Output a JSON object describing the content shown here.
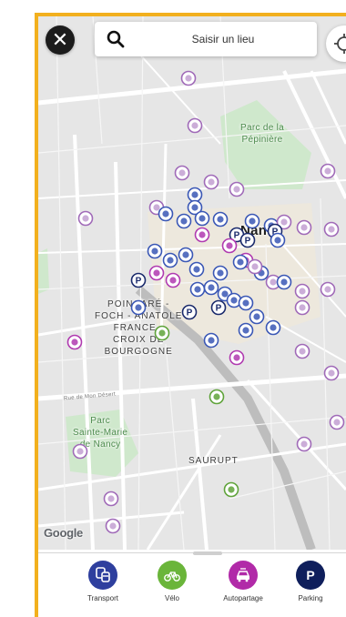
{
  "search": {
    "placeholder": "Saisir un lieu"
  },
  "controls": {
    "close_glyph": "✕"
  },
  "map": {
    "attribution": "Google",
    "labels": {
      "park_pepiniere": "Parc de la\nPépinière",
      "city": "Nancy",
      "district_poincare": "POINCARÉ -\nFOCH - ANATOLE\nFRANCE -\nCROIX DE\nBOURGOGNE",
      "park_sainte_marie": "Parc\nSainte-Marie\nde Nancy",
      "district_saurupt": "SAURUPT",
      "street_mon_desert": "Rue de Mon Désert"
    },
    "marker_colors": {
      "transport": "#3a57b5",
      "velo": "#5fa33a",
      "autopartage": "#b03ab0",
      "parking": "#1a2a6c",
      "poi": "#a06ab8"
    }
  },
  "categories": [
    {
      "label": "Transport",
      "icon": "bus-icon",
      "color": "#2e3f9e"
    },
    {
      "label": "Vélo",
      "icon": "bike-icon",
      "color": "#6ab53a"
    },
    {
      "label": "Autopartage",
      "icon": "car-share-icon",
      "color": "#b12aa8"
    },
    {
      "label": "Parking",
      "icon": "parking-icon",
      "color": "#0f1f5c"
    }
  ]
}
